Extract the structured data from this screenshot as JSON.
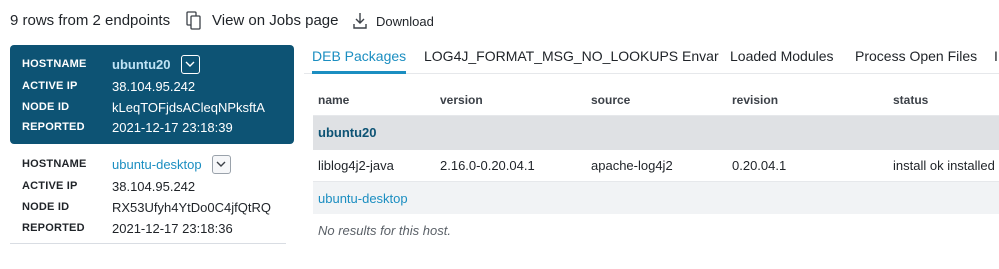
{
  "toolbar": {
    "rows_summary": "9 rows from 2 endpoints",
    "copy_icon": "copy-icon",
    "jobs_link": "View on Jobs page",
    "download_icon": "download-icon",
    "download_label": "Download"
  },
  "hosts": [
    {
      "hostname_label": "HOSTNAME",
      "hostname": "ubuntu20",
      "active_ip_label": "ACTIVE IP",
      "active_ip": "38.104.95.242",
      "node_id_label": "NODE ID",
      "node_id": "kLeqTOFjdsACleqNPksftA",
      "reported_label": "REPORTED",
      "reported": "2021-12-17 23:18:39",
      "selected": true
    },
    {
      "hostname_label": "HOSTNAME",
      "hostname": "ubuntu-desktop",
      "active_ip_label": "ACTIVE IP",
      "active_ip": "38.104.95.242",
      "node_id_label": "NODE ID",
      "node_id": "RX53Ufyh4YtDo0C4jfQtRQ",
      "reported_label": "REPORTED",
      "reported": "2021-12-17 23:18:36",
      "selected": false
    }
  ],
  "tabs": [
    {
      "label": "DEB Packages",
      "active": true
    },
    {
      "label": "LOG4J_FORMAT_MSG_NO_LOOKUPS Envar",
      "active": false
    },
    {
      "label": "Loaded Modules",
      "active": false
    },
    {
      "label": "Process Open Files",
      "active": false
    }
  ],
  "tab_overflow": "I",
  "table": {
    "columns": [
      "name",
      "version",
      "source",
      "revision",
      "status"
    ],
    "groups": [
      {
        "host": "ubuntu20",
        "rows": [
          [
            "liblog4j2-java",
            "2.16.0-0.20.04.1",
            "apache-log4j2",
            "0.20.04.1",
            "install ok installed"
          ]
        ]
      },
      {
        "host": "ubuntu-desktop",
        "empty_text": "No results for this host."
      }
    ]
  },
  "colors": {
    "selected_card": "#0d5374",
    "accent": "#1b8ec1",
    "group_band": "#dfe1e4"
  }
}
